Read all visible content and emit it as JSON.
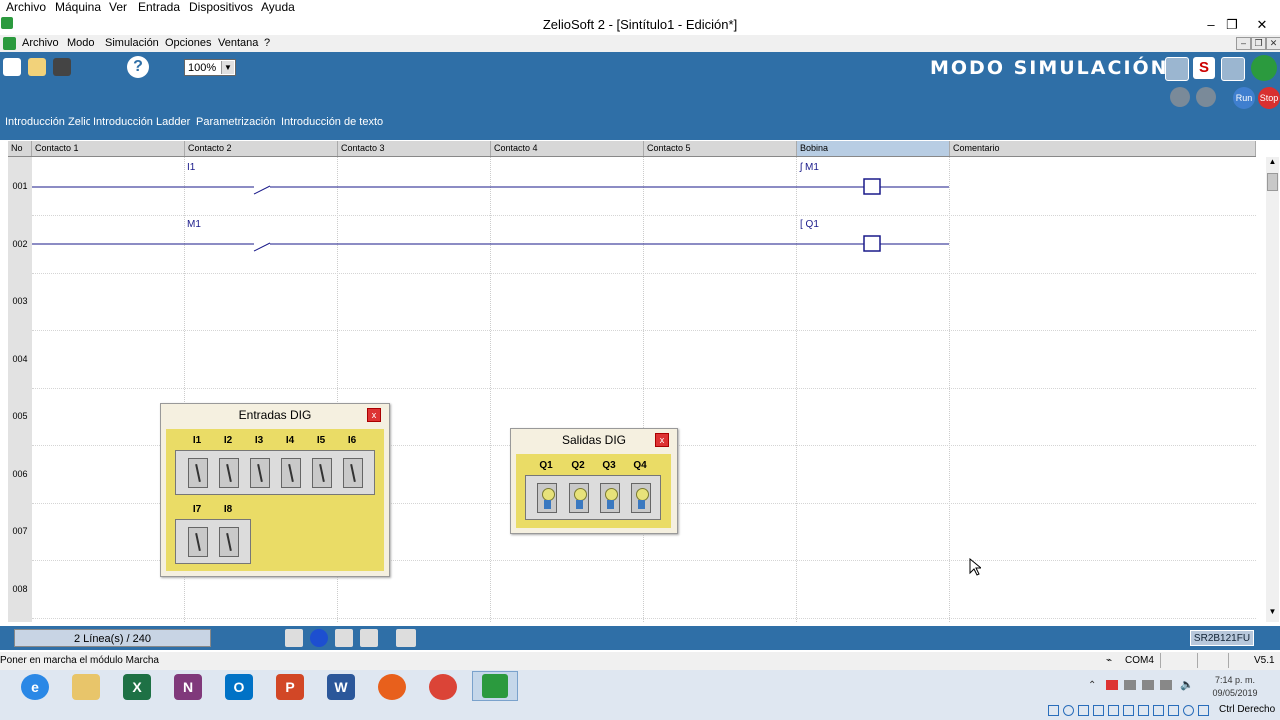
{
  "host_menu": {
    "items": [
      "Archivo",
      "Máquina",
      "Ver",
      "Entrada",
      "Dispositivos",
      "Ayuda"
    ]
  },
  "window": {
    "title": "ZelioSoft 2 - [Sintítulo1 - Edición*]"
  },
  "app_menu": {
    "items": [
      "Archivo",
      "Modo",
      "Simulación",
      "Opciones",
      "Ventana",
      "?"
    ]
  },
  "toolbar": {
    "zoom": "100%",
    "mode_label": "MODO SIMULACIÓN",
    "run_label": "Run",
    "stop_label": "Stop"
  },
  "tabs": [
    "Introducción Zelio",
    "Introducción Ladder",
    "Parametrización",
    "Introducción de texto"
  ],
  "grid": {
    "columns": [
      "No",
      "Contacto 1",
      "Contacto 2",
      "Contacto 3",
      "Contacto 4",
      "Contacto 5",
      "Bobina",
      "Comentario"
    ],
    "rows": [
      "001",
      "002",
      "003",
      "004",
      "005",
      "006",
      "007",
      "008"
    ],
    "rungs": [
      {
        "contact2": "I1",
        "coil": "ʃ M1"
      },
      {
        "contact2": "M1",
        "coil": "[ Q1"
      }
    ]
  },
  "inputs_window": {
    "title": "Entradas DIG",
    "close": "x",
    "labels_row1": [
      "I1",
      "I2",
      "I3",
      "I4",
      "I5",
      "I6"
    ],
    "labels_row2": [
      "I7",
      "I8"
    ]
  },
  "outputs_window": {
    "title": "Salidas DIG",
    "close": "x",
    "labels": [
      "Q1",
      "Q2",
      "Q3",
      "Q4"
    ]
  },
  "status": {
    "lines": "2 Línea(s) / 240",
    "module": "SR2B121FU"
  },
  "hint": {
    "text": "Poner en marcha el módulo Marcha",
    "port": "COM4",
    "version": "V5.1"
  },
  "taskbar": {
    "time": "7:14 p. m.",
    "date": "09/05/2019",
    "host_key": "Ctrl Derecho"
  },
  "colors": {
    "toolbar": "#2f6fa7",
    "panel": "#eadc66",
    "rung": "#1a1a8a"
  }
}
